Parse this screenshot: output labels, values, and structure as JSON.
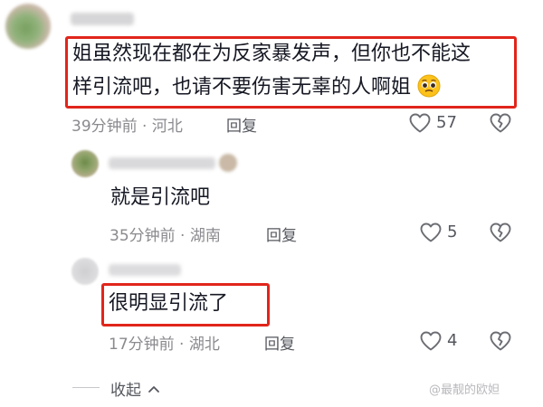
{
  "comments": [
    {
      "username": "",
      "text_line1": "姐虽然现在都在为反家暴发声，但你也不能这",
      "text_line2": "样引流吧，也请不要伤害无辜的人啊姐",
      "emoji": "pleading-face-emoji",
      "time": "39分钟前",
      "location": "河北",
      "reply_label": "回复",
      "likes": "57"
    },
    {
      "username": "",
      "text": "就是引流吧",
      "time": "35分钟前",
      "location": "湖南",
      "reply_label": "回复",
      "likes": "5"
    },
    {
      "username": "",
      "text": "很明显引流了",
      "time": "17分钟前",
      "location": "湖北",
      "reply_label": "回复",
      "likes": "4"
    }
  ],
  "collapse_label": "收起",
  "watermark": "@最靓的欧妲",
  "colors": {
    "highlight_border": "#e1251b",
    "meta_text": "#8a8a8f",
    "icon_stroke": "#6b6d73"
  }
}
